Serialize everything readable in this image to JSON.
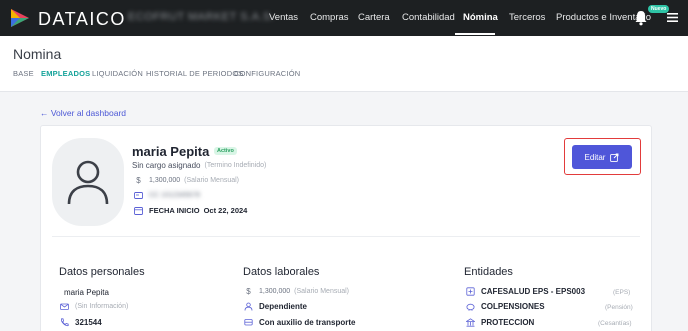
{
  "app": {
    "brand": "DATAICO",
    "company": "ECOFRUT MARKET S.A.S."
  },
  "nav": {
    "items": [
      "Ventas",
      "Compras",
      "Cartera",
      "Contabilidad",
      "Nómina",
      "Terceros",
      "Productos e Inventario"
    ],
    "active": "Nómina",
    "badge": "Nuevo",
    "colors": {
      "bar": "#1d2022",
      "badge": "#2ec4a6"
    }
  },
  "page": {
    "title": "Nomina",
    "subtabs": [
      "BASE",
      "EMPLEADOS",
      "LIQUIDACIÓN",
      "HISTORIAL DE PERIODOS",
      "CONFIGURACIÓN"
    ],
    "active_subtab": "EMPLEADOS",
    "back_link": "← Volver al dashboard"
  },
  "employee": {
    "name": "maria Pepita",
    "status": "Activo",
    "position": "Sin cargo asignado",
    "contract": "(Termino Indefinido)",
    "salary": "1,300,000",
    "salary_note": "(Salario Mensual)",
    "id_number": "CC 1012345678",
    "start_label": "FECHA INICIO",
    "start_date": "Oct 22, 2024",
    "edit_label": "Editar"
  },
  "sections": {
    "personal": {
      "title": "Datos personales",
      "name": "maria Pepita",
      "email": "(Sin Información)",
      "phone": "321544"
    },
    "labor": {
      "title": "Datos laborales",
      "salary": "1,300,000",
      "salary_note": "(Salario Mensual)",
      "type": "Dependiente",
      "transport": "Con auxilio de transporte"
    },
    "entities": {
      "title": "Entidades",
      "items": [
        {
          "name": "CAFESALUD EPS - EPS003",
          "kind": "(EPS)"
        },
        {
          "name": "COLPENSIONES",
          "kind": "(Pensión)"
        },
        {
          "name": "PROTECCION",
          "kind": "(Cesantías)"
        }
      ]
    }
  },
  "colors": {
    "accent": "#4f56d9",
    "teal": "#16a39a",
    "highlight": "#e23b3b",
    "active_badge": "#27a05e"
  }
}
